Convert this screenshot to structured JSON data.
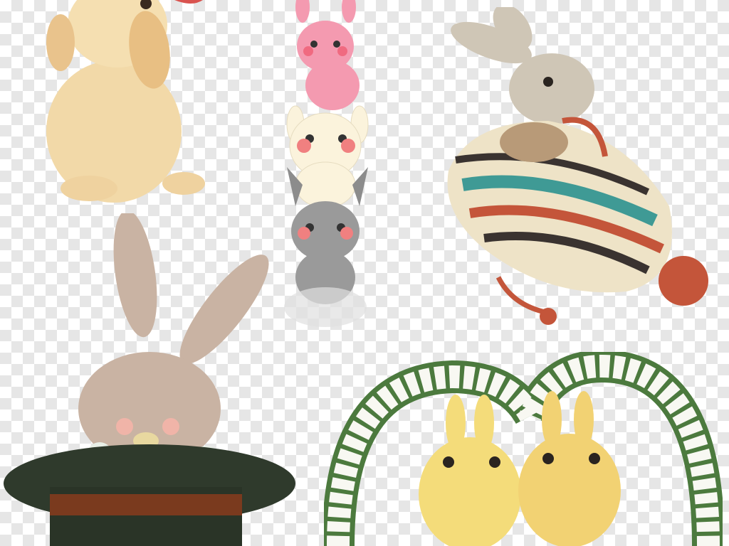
{
  "artworks": [
    {
      "name": "watercolor-lop-rabbit",
      "colors": {
        "fur": "#f2d9a8",
        "ear": "#e8bf83",
        "pink": "#d9534f"
      }
    },
    {
      "name": "stacked-cartoon-rabbits",
      "colors": {
        "pink": "#f49ab0",
        "cream": "#fbf3dc",
        "gray": "#9a9a9a",
        "blush": "#f08080"
      }
    },
    {
      "name": "rabbit-in-knit-bag",
      "colors": {
        "fur": "#cfc6b6",
        "teal": "#3f9a95",
        "red": "#c4553a",
        "cream": "#eee3c7",
        "dark": "#3a3330"
      }
    },
    {
      "name": "rabbit-in-top-hat",
      "colors": {
        "fur": "#c9b3a3",
        "hat": "#2f3a2c",
        "ribbon": "#7a3a1e",
        "chick": "#e8efe6"
      }
    },
    {
      "name": "yellow-rabbits-rose-wreath",
      "colors": {
        "fur": "#f4dc7a",
        "rose": "#f8f8f2",
        "leaf": "#4c7a3e"
      }
    }
  ]
}
